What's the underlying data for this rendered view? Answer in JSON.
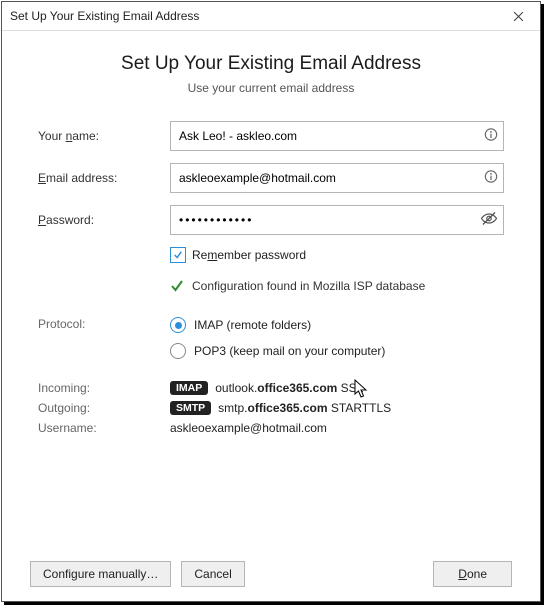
{
  "window": {
    "title": "Set Up Your Existing Email Address"
  },
  "header": {
    "heading": "Set Up Your Existing Email Address",
    "sub": "Use your current email address"
  },
  "fields": {
    "name_label_pre": "Your ",
    "name_label_u": "n",
    "name_label_post": "ame:",
    "name_value": "Ask Leo! - askleo.com",
    "email_label_u": "E",
    "email_label_post": "mail address:",
    "email_value": "askleoexample@hotmail.com",
    "password_label_u": "P",
    "password_label_post": "assword:",
    "password_value": "••••••••••••",
    "remember_pre": "Re",
    "remember_u": "m",
    "remember_post": "ember password"
  },
  "status": {
    "text": "Configuration found in Mozilla ISP database"
  },
  "protocol": {
    "label": "Protocol:",
    "imap": "IMAP (remote folders)",
    "pop3": "POP3 (keep mail on your computer)"
  },
  "server": {
    "incoming_label": "Incoming:",
    "outgoing_label": "Outgoing:",
    "username_label": "Username:",
    "imap_tag": "IMAP",
    "smtp_tag": "SMTP",
    "in_host_pre": "outlook.",
    "in_host_bold": "office365.com",
    "in_enc": " SSL",
    "out_host_pre": "smtp.",
    "out_host_bold": "office365.com",
    "out_enc": " STARTTLS",
    "username": "askleoexample@hotmail.com"
  },
  "buttons": {
    "configure": "Configure manually…",
    "cancel": "Cancel",
    "done_u": "D",
    "done_post": "one"
  }
}
